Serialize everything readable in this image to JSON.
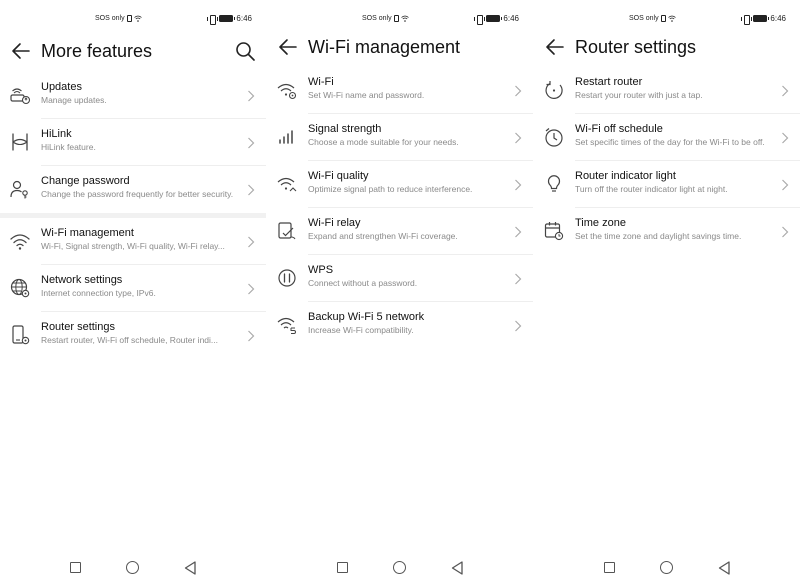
{
  "status_bar": {
    "left_text": "SOS only",
    "time": "6:46",
    "battery_label": "100"
  },
  "screens": [
    {
      "title": "More features",
      "has_search": true,
      "items": [
        {
          "icon": "router-update-icon",
          "label": "Updates",
          "sub": "Manage updates."
        },
        {
          "icon": "hilink-icon",
          "label": "HiLink",
          "sub": "HiLink feature."
        },
        {
          "icon": "user-key-icon",
          "label": "Change password",
          "sub": "Change the password frequently for better security."
        },
        {
          "icon": "wifi-icon",
          "label": "Wi-Fi management",
          "sub": "Wi-Fi, Signal strength, Wi-Fi quality, Wi-Fi relay..."
        },
        {
          "icon": "globe-gear-icon",
          "label": "Network settings",
          "sub": "Internet connection type, IPv6."
        },
        {
          "icon": "router-gear-icon",
          "label": "Router settings",
          "sub": "Restart router, Wi-Fi off schedule, Router indi..."
        }
      ]
    },
    {
      "title": "Wi-Fi management",
      "has_search": false,
      "items": [
        {
          "icon": "wifi-gear-icon",
          "label": "Wi-Fi",
          "sub": "Set Wi-Fi name and password."
        },
        {
          "icon": "signal-bars-icon",
          "label": "Signal strength",
          "sub": "Choose a mode suitable for your needs."
        },
        {
          "icon": "wifi-quality-icon",
          "label": "Wi-Fi quality",
          "sub": "Optimize signal path to reduce interference."
        },
        {
          "icon": "wifi-relay-icon",
          "label": "Wi-Fi relay",
          "sub": "Expand and strengthen Wi-Fi coverage."
        },
        {
          "icon": "wps-icon",
          "label": "WPS",
          "sub": "Connect without a password."
        },
        {
          "icon": "wifi-5-icon",
          "label": "Backup Wi-Fi 5 network",
          "sub": "Increase Wi-Fi compatibility."
        }
      ]
    },
    {
      "title": "Router settings",
      "has_search": false,
      "items": [
        {
          "icon": "restart-icon",
          "label": "Restart router",
          "sub": "Restart your router with just a tap."
        },
        {
          "icon": "timer-icon",
          "label": "Wi-Fi off schedule",
          "sub": "Set specific times of the day for the Wi-Fi to be off."
        },
        {
          "icon": "lightbulb-icon",
          "label": "Router indicator light",
          "sub": "Turn off the router indicator light at night."
        },
        {
          "icon": "calendar-clock-icon",
          "label": "Time zone",
          "sub": "Set the time zone and daylight savings time."
        }
      ]
    }
  ],
  "colors": {
    "text_primary": "#111111",
    "text_secondary": "#8a8a8a",
    "divider": "#eeeeee",
    "icon": "#444444"
  }
}
